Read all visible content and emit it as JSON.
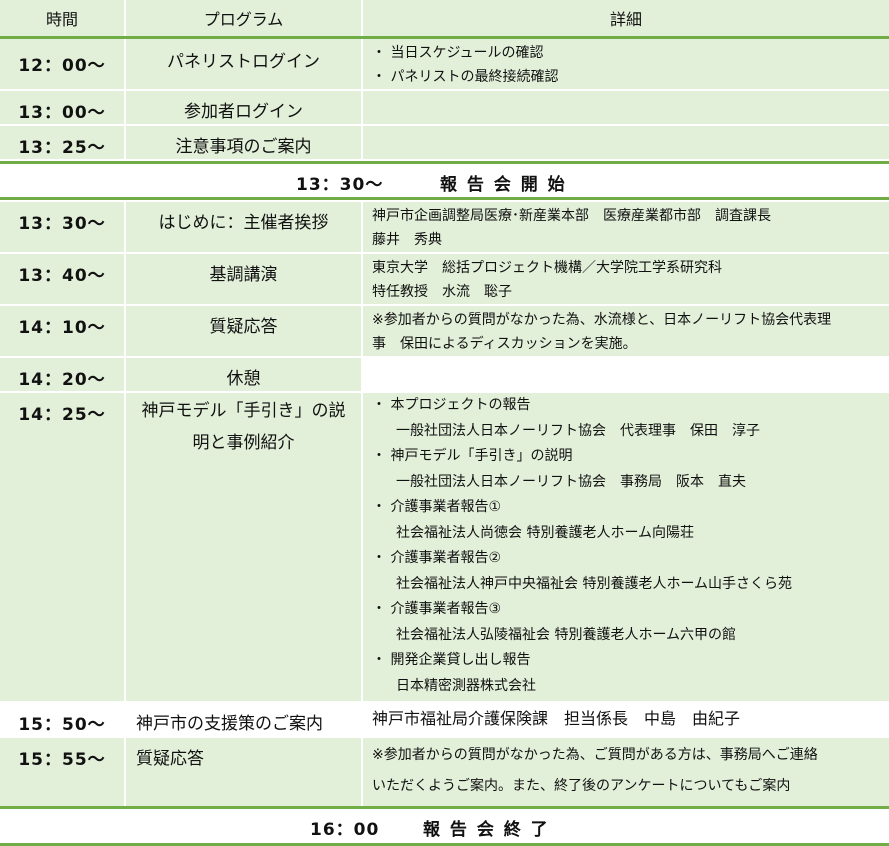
{
  "header": {
    "time": "時間",
    "program": "プログラム",
    "detail": "詳細"
  },
  "rows": [
    {
      "time": "12：00～",
      "program": "パネリストログイン",
      "details": [
        "・ 当日スケジュールの確認",
        "・ パネリストの最終接続確認"
      ]
    },
    {
      "time": "13：00～",
      "program": "参加者ログイン",
      "details": []
    },
    {
      "time": "13：25～",
      "program": "注意事項のご案内",
      "details": []
    },
    {
      "time": "13：30～",
      "program": "はじめに：主催者挨拶",
      "details": [
        "神戸市企画調整局医療･新産業本部　医療産業都市部　調査課長",
        "藤井　秀典"
      ]
    },
    {
      "time": "13：40～",
      "program": "基調講演",
      "details": [
        "東京大学　総括プロジェクト機構／大学院工学系研究科",
        "特任教授　水流　聡子"
      ]
    },
    {
      "time": "14：10～",
      "program": "質疑応答",
      "details": [
        "※参加者からの質問がなかった為、水流様と、日本ノーリフト協会代表理",
        "事　保田によるディスカッションを実施。"
      ]
    },
    {
      "time": "14：20～",
      "program": "休憩",
      "details": []
    },
    {
      "time": "14：25～",
      "program": [
        "神戸モデル「手引き」の説",
        "明と事例紹介"
      ],
      "details": [
        {
          "b": "・ 本プロジェクトの報告",
          "s": "一般社団法人日本ノーリフト協会　代表理事　保田　淳子"
        },
        {
          "b": "・ 神戸モデル「手引き」の説明",
          "s": "一般社団法人日本ノーリフト協会　事務局　阪本　直夫"
        },
        {
          "b": "・ 介護事業者報告①",
          "s": "社会福祉法人尚徳会 特別養護老人ホーム向陽荘"
        },
        {
          "b": "・ 介護事業者報告②",
          "s": "社会福祉法人神戸中央福祉会 特別養護老人ホーム山手さくら苑"
        },
        {
          "b": "・ 介護事業者報告③",
          "s": "社会福祉法人弘陵福祉会 特別養護老人ホーム六甲の館"
        },
        {
          "b": "・ 開発企業貸し出し報告",
          "s": "日本精密測器株式会社"
        }
      ]
    },
    {
      "time": "15：50～",
      "program": "神戸市の支援策のご案内",
      "details": [
        "神戸市福祉局介護保険課　担当係長　中島　由紀子"
      ]
    },
    {
      "time": "15：55～",
      "program": "質疑応答",
      "details": [
        "※参加者からの質問がなかった為、ご質問がある方は、事務局へご連絡",
        "いただくようご案内。また、終了後のアンケートについてもご案内"
      ]
    }
  ],
  "banners": [
    {
      "time": "13：30～",
      "label": "報 告 会 開 始"
    },
    {
      "time": "16：00",
      "label": "報 告 会 終 了"
    }
  ]
}
